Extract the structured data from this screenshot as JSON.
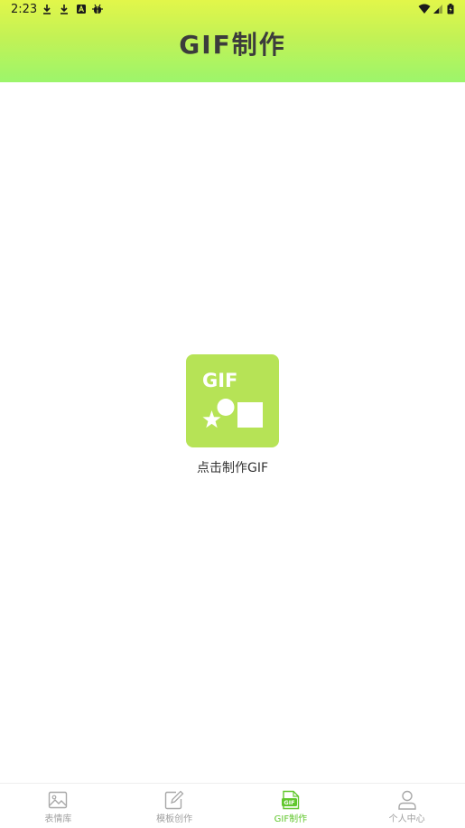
{
  "status_bar": {
    "time": "2:23",
    "icons": [
      "download-icon",
      "download-icon",
      "a-notification-icon",
      "bug-icon",
      "wifi-icon",
      "signal-icon",
      "battery-icon"
    ]
  },
  "header": {
    "title": "GIF制作",
    "gradient_top": "#e2f64a",
    "gradient_bottom": "#9cf56b"
  },
  "main": {
    "card_text": "GIF",
    "card_color": "#b6e356",
    "label": "点击制作GIF"
  },
  "bottom_nav": {
    "active_color": "#62c72e",
    "inactive_color": "#a0a0a0",
    "items": [
      {
        "label": "表情库",
        "icon": "image-icon",
        "active": false
      },
      {
        "label": "模板创作",
        "icon": "edit-icon",
        "active": false
      },
      {
        "label": "GIF制作",
        "icon": "gif-file-icon",
        "active": true
      },
      {
        "label": "个人中心",
        "icon": "person-icon",
        "active": false
      }
    ]
  }
}
